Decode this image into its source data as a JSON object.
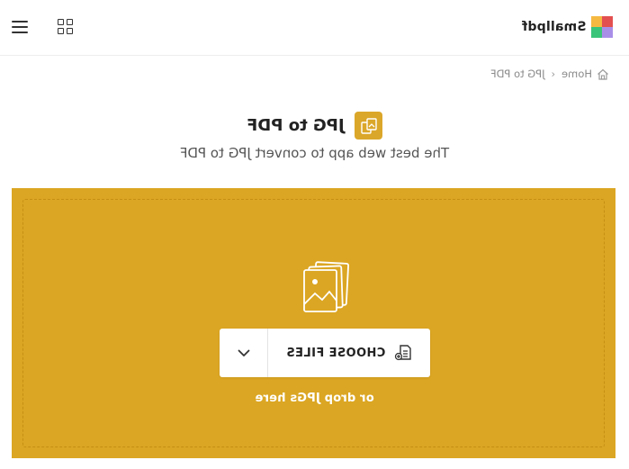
{
  "header": {
    "logo_text": "Smallpdf",
    "logo_colors": [
      "#e35050",
      "#f5b942",
      "#58a1f0",
      "#3ac47a"
    ],
    "menu_icon": "hamburger-menu-icon",
    "apps_icon": "grid-apps-icon"
  },
  "breadcrumb": {
    "home_label": "Home",
    "separator": "›",
    "current_label": "JPG to PDF",
    "home_icon": "home-icon"
  },
  "tool": {
    "title": "JPG to PDF",
    "subtitle": "The best web app to convert JPG to PDF",
    "icon": "jpg-to-pdf-icon",
    "accent_color": "#dba72a"
  },
  "dropzone": {
    "background_color": "#dba623",
    "art_icon": "image-files-icon",
    "choose_label": "CHOOSE FILES",
    "choose_icon": "file-upload-icon",
    "dropdown_icon": "chevron-down-icon",
    "hint": "or drop JPGs here"
  }
}
